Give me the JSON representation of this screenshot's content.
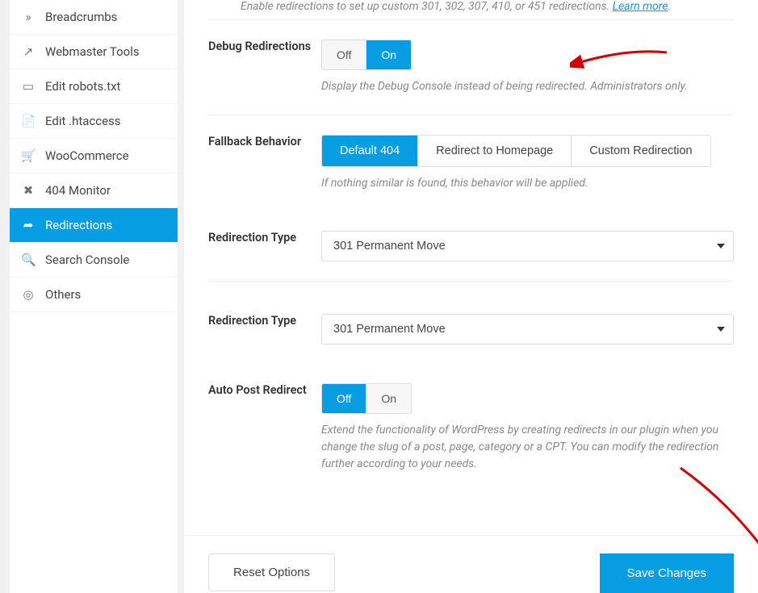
{
  "intro": {
    "prefix": "Enable redirections to set up custom 301, 302, 307, 410, or 451 redirections. ",
    "link": "Learn more",
    "suffix": "."
  },
  "sidebar": {
    "items": [
      {
        "label": "Breadcrumbs",
        "icon": "»"
      },
      {
        "label": "Webmaster Tools",
        "icon": "↗"
      },
      {
        "label": "Edit robots.txt",
        "icon": "▭"
      },
      {
        "label": "Edit .htaccess",
        "icon": "📄"
      },
      {
        "label": "WooCommerce",
        "icon": "🛒"
      },
      {
        "label": "404 Monitor",
        "icon": "✖"
      },
      {
        "label": "Redirections",
        "icon": "➦",
        "active": true
      },
      {
        "label": "Search Console",
        "icon": "🔍"
      },
      {
        "label": "Others",
        "icon": "◎"
      }
    ]
  },
  "rows": {
    "debug": {
      "label": "Debug Redirections",
      "off": "Off",
      "on": "On",
      "selected": "on",
      "help": "Display the Debug Console instead of being redirected. Administrators only."
    },
    "fallback": {
      "label": "Fallback Behavior",
      "opt1": "Default 404",
      "opt2": "Redirect to Homepage",
      "opt3": "Custom Redirection",
      "selected": "opt1",
      "help": "If nothing similar is found, this behavior will be applied."
    },
    "redir_type_1": {
      "label": "Redirection Type",
      "value": "301 Permanent Move"
    },
    "redir_type_2": {
      "label": "Redirection Type",
      "value": "301 Permanent Move"
    },
    "autopost": {
      "label": "Auto Post Redirect",
      "off": "Off",
      "on": "On",
      "selected": "off",
      "help": "Extend the functionality of WordPress by creating redirects in our plugin when you change the slug of a post, page, category or a CPT. You can modify the redirection further according to your needs."
    }
  },
  "footer": {
    "reset": "Reset Options",
    "save": "Save Changes"
  }
}
